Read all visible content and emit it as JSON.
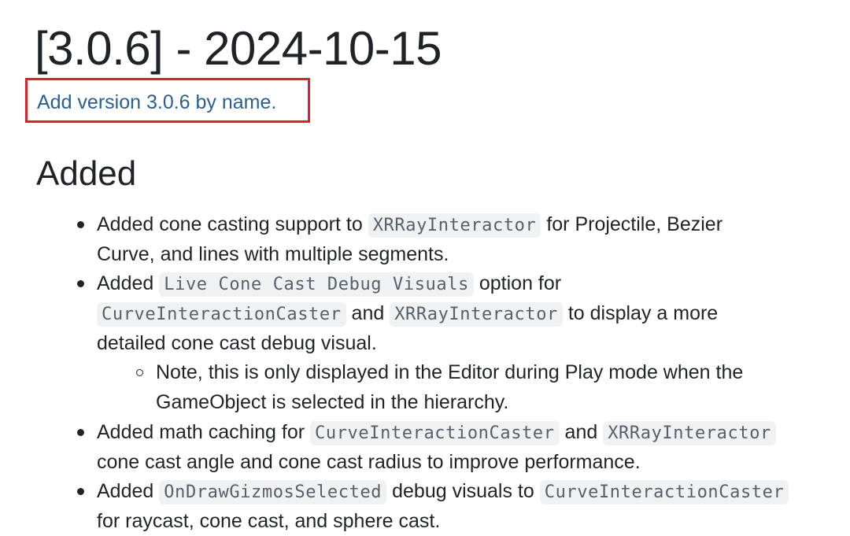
{
  "title": "[3.0.6] - 2024-10-15",
  "highlight_link": "Add version 3.0.6 by name.",
  "section": "Added",
  "items": [
    {
      "l1a": "Added cone casting support to ",
      "c1": "XRRayInteractor",
      "l1b": " for Projectile, Bezier",
      "l2": "Curve, and lines with multiple segments."
    },
    {
      "l1a": "Added ",
      "c1": "Live Cone Cast Debug Visuals",
      "l1b": " option for",
      "c2": "CurveInteractionCaster",
      "l2b": " and ",
      "c3": "XRRayInteractor",
      "l2c": " to display a more",
      "l3": "detailed cone cast debug visual.",
      "sub": {
        "l1": "Note, this is only displayed in the Editor during Play mode when the",
        "l2": "GameObject is selected in the hierarchy."
      }
    },
    {
      "l1a": "Added math caching for ",
      "c1": "CurveInteractionCaster",
      "l1b": " and ",
      "c2": "XRRayInteractor",
      "l2": "cone cast angle and cone cast radius to improve performance."
    },
    {
      "l1a": "Added ",
      "c1": "OnDrawGizmosSelected",
      "l1b": " debug visuals to ",
      "c2": "CurveInteractionCaster",
      "l2": "for raycast, cone cast, and sphere cast."
    }
  ],
  "colors": {
    "text": "#1f2328",
    "link": "#2a5f8f",
    "highlight_border": "#d9232e",
    "code_bg": "#f0f1f2",
    "code_text": "#57606a"
  }
}
